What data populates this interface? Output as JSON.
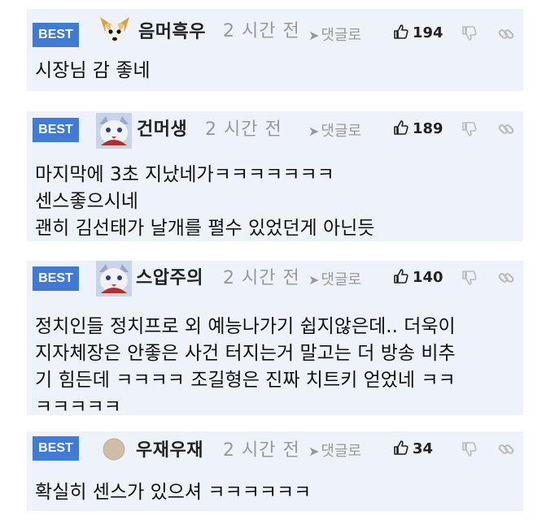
{
  "comments": [
    {
      "badge": "BEST",
      "nickname": "음머흑우",
      "time": "2 시간 전",
      "reply_label": "댓글로",
      "likes": "194",
      "avatar_icon": "dog-avatar-icon",
      "lines": [
        "시장님 감 좋네"
      ]
    },
    {
      "badge": "BEST",
      "nickname": "건머생",
      "time": "2 시간 전",
      "reply_label": "댓글로",
      "likes": "189",
      "avatar_icon": "cat-avatar-icon",
      "lines": [
        "마지막에 3초 지났네가ㅋㅋㅋㅋㅋㅋㅋ",
        "센스좋으시네",
        "괜히 김선태가 날개를 펼수 있었던게 아닌듯"
      ]
    },
    {
      "badge": "BEST",
      "nickname": "스압주의",
      "time": "2 시간 전",
      "reply_label": "댓글로",
      "likes": "140",
      "avatar_icon": "cat-avatar-icon",
      "lines": [
        "정치인들 정치프로 외 예능나가기 쉽지않은데.. 더욱이",
        "지자체장은 안좋은 사건 터지는거 말고는 더 방송 비추",
        "기 힘든데 ㅋㅋㅋㅋ 조길형은 진짜 치트키 얻었네 ㅋㅋ",
        "ㅋㅋㅋㅋㅋ"
      ]
    },
    {
      "badge": "BEST",
      "nickname": "우재우재",
      "time": "2 시간 전",
      "reply_label": "댓글로",
      "likes": "34",
      "avatar_icon": "default-avatar-icon",
      "lines": [
        "확실히 센스가 있으셔 ㅋㅋㅋㅋㅋㅋ"
      ]
    }
  ]
}
